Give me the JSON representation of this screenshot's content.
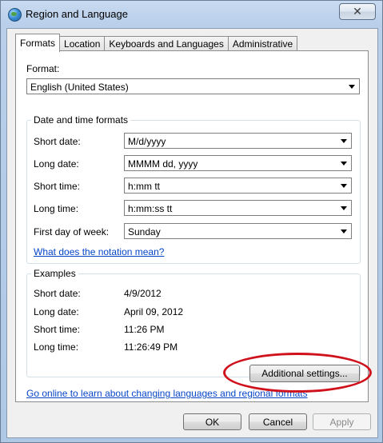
{
  "window": {
    "title": "Region and Language",
    "close_glyph": "✕"
  },
  "tabs": [
    {
      "label": "Formats",
      "active": true
    },
    {
      "label": "Location",
      "active": false
    },
    {
      "label": "Keyboards and Languages",
      "active": false
    },
    {
      "label": "Administrative",
      "active": false
    }
  ],
  "format": {
    "label": "Format:",
    "value": "English (United States)"
  },
  "date_time": {
    "group_title": "Date and time formats",
    "rows": [
      {
        "label": "Short date:",
        "value": "M/d/yyyy"
      },
      {
        "label": "Long date:",
        "value": "MMMM dd, yyyy"
      },
      {
        "label": "Short time:",
        "value": "h:mm tt"
      },
      {
        "label": "Long time:",
        "value": "h:mm:ss tt"
      },
      {
        "label": "First day of week:",
        "value": "Sunday"
      }
    ],
    "notation_link": "What does the notation mean?"
  },
  "examples": {
    "group_title": "Examples",
    "rows": [
      {
        "label": "Short date:",
        "value": "4/9/2012"
      },
      {
        "label": "Long date:",
        "value": "April 09, 2012"
      },
      {
        "label": "Short time:",
        "value": "11:26 PM"
      },
      {
        "label": "Long time:",
        "value": "11:26:49 PM"
      }
    ]
  },
  "additional_settings": "Additional settings...",
  "online_link": "Go online to learn about changing languages and regional formats",
  "buttons": {
    "ok": "OK",
    "cancel": "Cancel",
    "apply": "Apply"
  },
  "colors": {
    "annotation_ellipse": "#d0111b",
    "link": "#0645c8"
  }
}
